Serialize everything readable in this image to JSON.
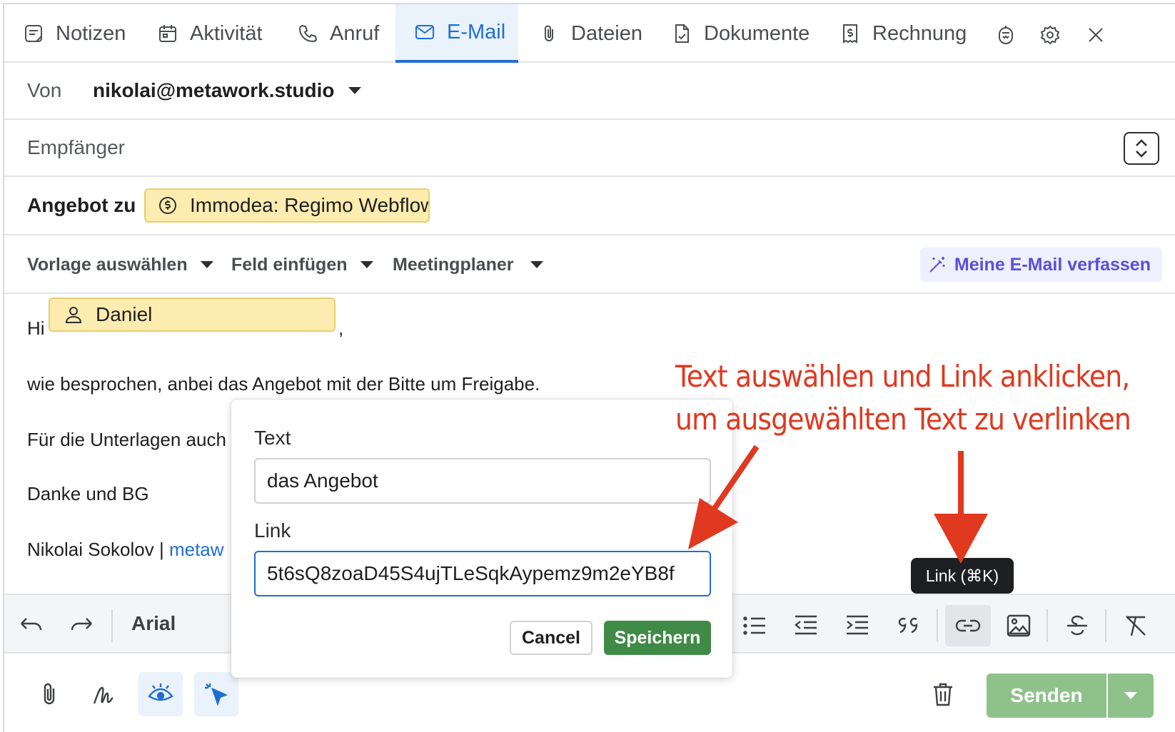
{
  "tabs": [
    {
      "label": "Notizen",
      "icon": "note-icon"
    },
    {
      "label": "Aktivität",
      "icon": "calendar-icon"
    },
    {
      "label": "Anruf",
      "icon": "phone-icon"
    },
    {
      "label": "E-Mail",
      "icon": "mail-icon",
      "active": true
    },
    {
      "label": "Dateien",
      "icon": "paperclip-icon"
    },
    {
      "label": "Dokumente",
      "icon": "document-icon"
    },
    {
      "label": "Rechnung",
      "icon": "invoice-icon"
    }
  ],
  "header_icons": [
    "ai-assistant-icon",
    "gear-icon",
    "close-icon"
  ],
  "compose": {
    "from_label": "Von",
    "from_value": "nikolai@metawork.studio",
    "to_label": "Empfänger",
    "subject_label": "Angebot zu",
    "deal_chip": "Immodea: Regimo Webflow"
  },
  "tools": {
    "template": "Vorlage auswählen",
    "insert_field": "Feld einfügen",
    "meeting": "Meetingplaner",
    "compose_ai": "Meine E-Mail verfassen"
  },
  "body": {
    "greeting": "Hi",
    "name_chip": "Daniel",
    "comma": ",",
    "line1": "wie besprochen, anbei das Angebot mit der Bitte um Freigabe.",
    "line2": "Für die Unterlagen auch",
    "line3": "Danke und BG",
    "line4": "Nikolai Sokolov | ",
    "signature_link": "metaw"
  },
  "format_bar": {
    "font": "Arial",
    "tooltip": "Link (⌘K)"
  },
  "link_dialog": {
    "text_label": "Text",
    "text_value": "das Angebot",
    "link_label": "Link",
    "link_value": "5t6sQ8zoaD45S4ujTLeSqkAypemz9m2eYB8f",
    "cancel": "Cancel",
    "save": "Speichern"
  },
  "footer": {
    "send": "Senden"
  },
  "annotation": {
    "line1": "Text auswählen und Link anklicken,",
    "line2": "um ausgewählten Text zu verlinken",
    "color": "#e0391f"
  },
  "colors": {
    "accent": "#1f6fd1",
    "chip": "#fcecb0",
    "save": "#3f8a46",
    "send": "#8fc28a",
    "ai": "#5a4fd8"
  }
}
